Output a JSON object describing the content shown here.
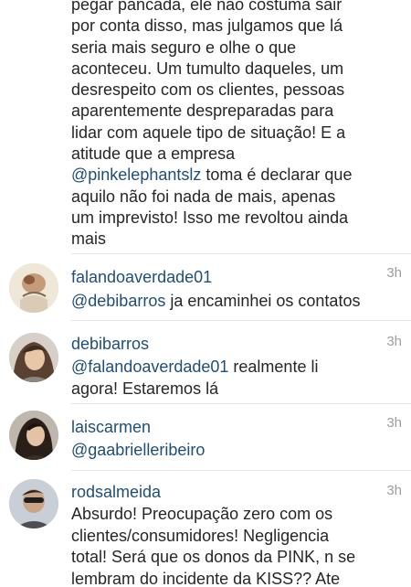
{
  "caption": {
    "lines": [
      "pegar pancada, ele não costuma sair",
      "por conta disso, mas julgamos que lá",
      "seria mais seguro e olhe o que",
      "aconteceu. Um tumulto daqueles, um",
      "desrespeito com os clientes,  pessoas",
      "aparentemente despreparadas para",
      "lidar com aquele tipo de situação!  E a",
      "atitude que a empresa"
    ],
    "mention": "@pinkelephantslz",
    "after_mention": " toma é declarar que",
    "tail_lines": [
      "aquilo não foi nada de mais, apenas",
      "um imprevisto! Isso me revoltou ainda",
      "mais"
    ]
  },
  "comments": [
    {
      "username": "falandoaverdade01",
      "time": "3h",
      "mention": "@debibarros",
      "text": " ja encaminhei os contatos",
      "avatar_icon": "avatar-photo-icon"
    },
    {
      "username": "debibarros",
      "time": "3h",
      "mention": "@falandoaverdade01",
      "text": "  realmente li",
      "text2": "agora! Estaremos lá",
      "avatar_icon": "avatar-photo-icon"
    },
    {
      "username": "laiscarmen",
      "time": "3h",
      "mention": "@gaabrielleribeiro",
      "avatar_icon": "avatar-photo-icon"
    },
    {
      "username": "rodsalmeida",
      "time": "3h",
      "lines": [
        "Absurdo! Preocupação zero com os",
        "clientes/consumidores! Negligencia",
        "total! Será que os donos da PINK, n se",
        "lembram do incidente da KISS?? Ate"
      ],
      "avatar_icon": "avatar-photo-icon"
    }
  ],
  "colors": {
    "link": "#1f4e79",
    "text": "#262626",
    "time": "#9e9e9e",
    "divider": "#e4e4e4"
  }
}
